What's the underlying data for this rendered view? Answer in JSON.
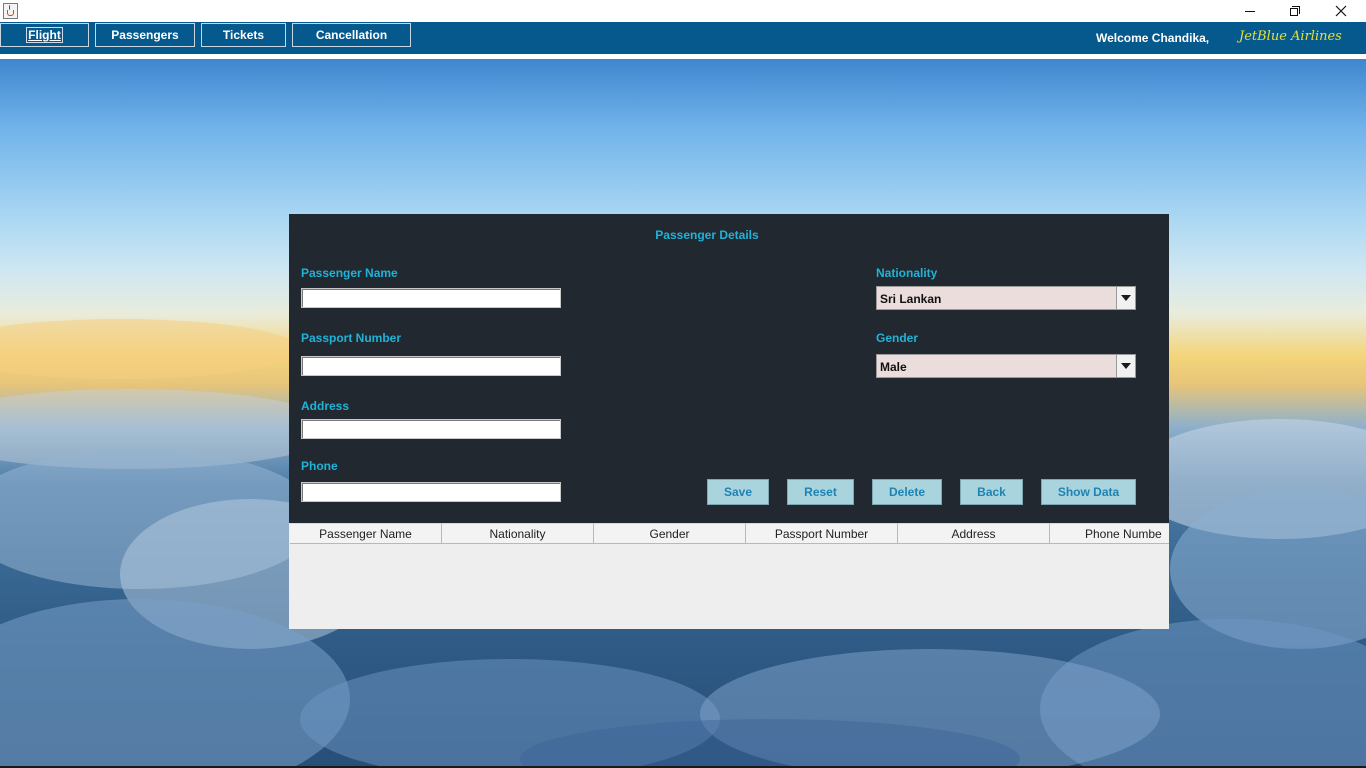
{
  "window": {
    "icon": "java-app-icon",
    "controls": [
      "minimize-icon",
      "maximize-icon",
      "close-icon"
    ]
  },
  "nav": {
    "flight": "Flight",
    "passengers": "Passengers",
    "tickets": "Tickets",
    "cancellation": "Cancellation",
    "welcome": "Welcome Chandika,",
    "brand": "JetBlue Airlines"
  },
  "form": {
    "title": "Passenger Details",
    "passenger_name_label": "Passenger Name",
    "passenger_name_value": "",
    "passport_number_label": "Passport Number",
    "passport_number_value": "",
    "address_label": "Address",
    "address_value": "",
    "phone_label": "Phone",
    "phone_value": "",
    "nationality_label": "Nationality",
    "nationality_value": "Sri Lankan",
    "gender_label": "Gender",
    "gender_value": "Male"
  },
  "actions": {
    "save": "Save",
    "reset": "Reset",
    "delete": "Delete",
    "back": "Back",
    "show_data": "Show Data"
  },
  "table": {
    "columns": [
      "Passenger Name",
      "Nationality",
      "Gender",
      "Passport Number",
      "Address",
      "Phone Numbe"
    ],
    "rows": []
  },
  "colors": {
    "navbar": "#06598c",
    "panel": "#212830",
    "label_accent": "#1fb3d8",
    "brand_text": "#e6e033",
    "button_bg": "#aad4dd"
  }
}
